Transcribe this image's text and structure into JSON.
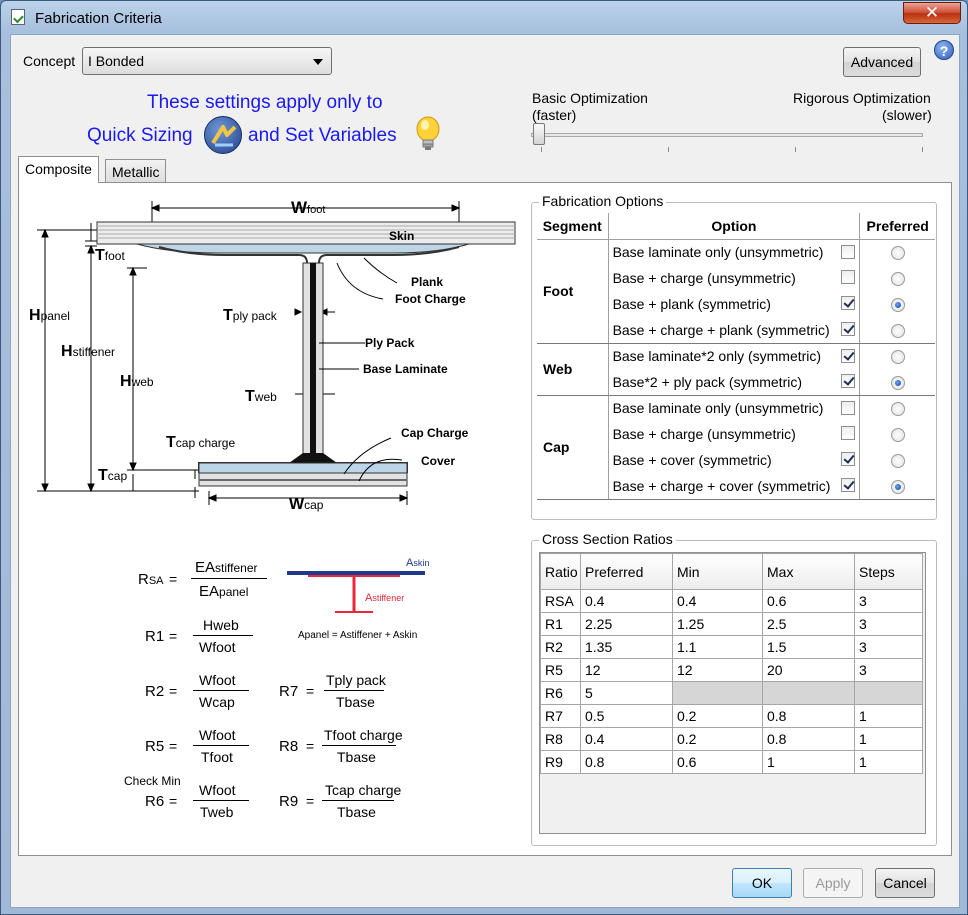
{
  "window": {
    "title": "Fabrication Criteria",
    "close_glyph": "✕"
  },
  "concept": {
    "label": "Concept",
    "value": "I Bonded"
  },
  "advanced_label": "Advanced",
  "help_glyph": "?",
  "note": {
    "line1": "These settings apply only to",
    "line2a": "Quick Sizing",
    "line2b": "and Set Variables"
  },
  "optimization": {
    "left_label": "Basic Optimization",
    "left_sub": "(faster)",
    "right_label": "Rigorous Optimization",
    "right_sub": "(slower)",
    "level": 0
  },
  "tabs": [
    {
      "label": "Composite"
    },
    {
      "label": "Metallic"
    }
  ],
  "diagram": {
    "labels": {
      "wfoot_main": "W",
      "wfoot_sub": "foot",
      "skin": "Skin",
      "tfoot_main": "T",
      "tfoot_sub": "foot",
      "plank": "Plank",
      "foot_charge": "Foot Charge",
      "hpanel_main": "H",
      "hpanel_sub": "panel",
      "tply_main": "T",
      "tply_sub": "ply pack",
      "ply_pack": "Ply Pack",
      "base_laminate": "Base Laminate",
      "hstiff_main": "H",
      "hstiff_sub": "stiffener",
      "hweb_main": "H",
      "hweb_sub": "web",
      "tweb_main": "T",
      "tweb_sub": "web",
      "tcapcharge_main": "T",
      "tcapcharge_sub": "cap charge",
      "cap_charge": "Cap Charge",
      "cover": "Cover",
      "tcap_main": "T",
      "tcap_sub": "cap",
      "wcap_main": "W",
      "wcap_sub": "cap"
    }
  },
  "formulas": {
    "rsa_lhs_main": "R",
    "rsa_lhs_sub": "SA",
    "rsa_num_main": "EA",
    "rsa_num_sub": "stiffener",
    "rsa_den_main": "EA",
    "rsa_den_sub": "panel",
    "askin_main": "A",
    "askin_sub": "skin",
    "astiff_main": "A",
    "astiff_sub": "stiffener",
    "apanel_eq": "Apanel = Astiffener + Askin",
    "r1_lhs": "R1",
    "r1_num": "Hweb",
    "r1_den": "Wfoot",
    "r2_lhs": "R2",
    "r2_num": "Wfoot",
    "r2_den": "Wcap",
    "r7_lhs": "R7",
    "r7_num": "Tply pack",
    "r7_den": "Tbase",
    "r5_lhs": "R5",
    "r5_num": "Wfoot",
    "r5_den": "Tfoot",
    "r8_lhs": "R8",
    "r8_num": "Tfoot charge",
    "r8_den": "Tbase",
    "check_min": "Check Min",
    "r6_lhs": "R6",
    "r6_num": "Wfoot",
    "r6_den": "Tweb",
    "r9_lhs": "R9",
    "r9_num": "Tcap charge",
    "r9_den": "Tbase",
    "eq": "="
  },
  "fabrication_options": {
    "title": "Fabrication Options",
    "headers": {
      "segment": "Segment",
      "option": "Option",
      "preferred": "Preferred"
    },
    "groups": [
      {
        "segment": "Foot",
        "options": [
          {
            "label": "Base laminate only (unsymmetric)",
            "checked": false,
            "preferred": false
          },
          {
            "label": "Base + charge (unsymmetric)",
            "checked": false,
            "preferred": false
          },
          {
            "label": "Base + plank (symmetric)",
            "checked": true,
            "preferred": true
          },
          {
            "label": "Base + charge + plank (symmetric)",
            "checked": true,
            "preferred": false
          }
        ]
      },
      {
        "segment": "Web",
        "options": [
          {
            "label": "Base laminate*2 only (symmetric)",
            "checked": true,
            "preferred": false
          },
          {
            "label": "Base*2 + ply pack (symmetric)",
            "checked": true,
            "preferred": true
          }
        ]
      },
      {
        "segment": "Cap",
        "options": [
          {
            "label": "Base laminate only (unsymmetric)",
            "checked": false,
            "preferred": false
          },
          {
            "label": "Base + charge (unsymmetric)",
            "checked": false,
            "preferred": false
          },
          {
            "label": "Base + cover (symmetric)",
            "checked": true,
            "preferred": false
          },
          {
            "label": "Base + charge + cover (symmetric)",
            "checked": true,
            "preferred": true
          }
        ]
      }
    ]
  },
  "cross_section": {
    "title": "Cross Section Ratios",
    "headers": [
      "Ratio",
      "Preferred",
      "Min",
      "Max",
      "Steps"
    ],
    "rows": [
      [
        "RSA",
        "0.4",
        "0.4",
        "0.6",
        "3"
      ],
      [
        "R1",
        "2.25",
        "1.25",
        "2.5",
        "3"
      ],
      [
        "R2",
        "1.35",
        "1.1",
        "1.5",
        "3"
      ],
      [
        "R5",
        "12",
        "12",
        "20",
        "3"
      ],
      [
        "R6",
        "5",
        "",
        "",
        ""
      ],
      [
        "R7",
        "0.5",
        "0.2",
        "0.8",
        "1"
      ],
      [
        "R8",
        "0.4",
        "0.2",
        "0.8",
        "1"
      ],
      [
        "R9",
        "0.8",
        "0.6",
        "1",
        "1"
      ]
    ]
  },
  "buttons": {
    "ok": "OK",
    "apply": "Apply",
    "cancel": "Cancel"
  },
  "colors": {
    "accent_blue": "#1a1aee",
    "skin_blue": "#1f3a8a",
    "stiffener_red": "#e8283a",
    "laminate_fill": "#bcd6e8"
  }
}
